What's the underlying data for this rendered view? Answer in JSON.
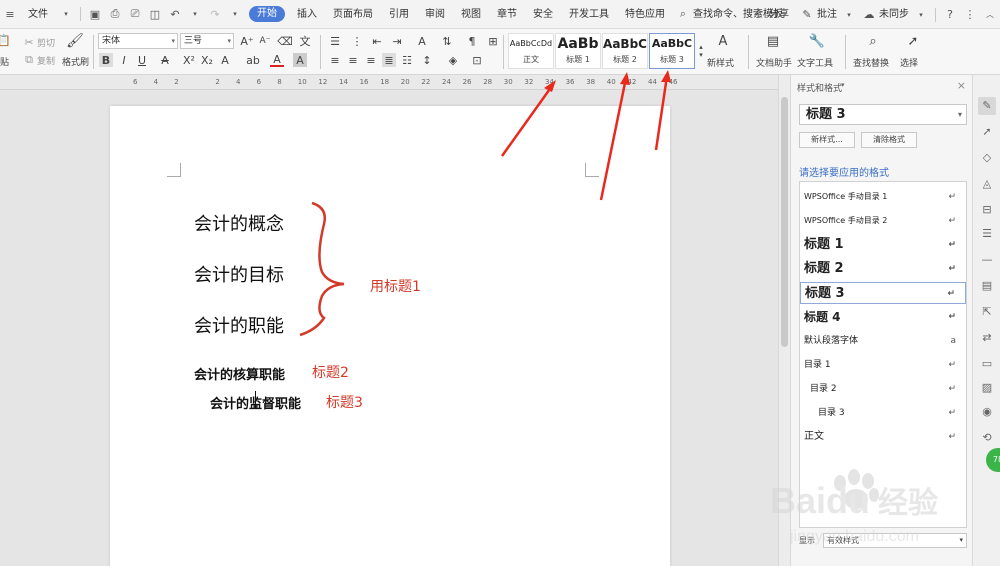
{
  "menubar": {
    "file_label": "文件",
    "tabs": [
      "开始",
      "插入",
      "页面布局",
      "引用",
      "审阅",
      "视图",
      "章节",
      "安全",
      "开发工具",
      "特色应用"
    ],
    "active_tab": "开始",
    "search_label": "查找命令、搜索模板",
    "share_label": "分享",
    "comment_label": "批注",
    "sync_label": "未同步"
  },
  "ribbon": {
    "cut_label": "剪切",
    "copy_label": "复制",
    "paste_label": "贴",
    "format_painter_label": "格式刷",
    "font_name": "宋体",
    "font_size": "三号",
    "styles": [
      {
        "preview": "AaBbCcDd",
        "name": "正文"
      },
      {
        "preview": "AaBb",
        "name": "标题 1"
      },
      {
        "preview": "AaBbC",
        "name": "标题 2"
      },
      {
        "preview": "AaBbC",
        "name": "标题 3"
      }
    ],
    "new_style_label": "新样式",
    "doc_helper_label": "文档助手",
    "text_tools_label": "文字工具",
    "find_replace_label": "查找替换",
    "select_label": "选择"
  },
  "ruler": {
    "ticks": [
      "6",
      "4",
      "2",
      "",
      "2",
      "4",
      "6",
      "8",
      "10",
      "12",
      "14",
      "16",
      "18",
      "20",
      "22",
      "24",
      "26",
      "28",
      "30",
      "32",
      "34",
      "36",
      "38",
      "40",
      "42",
      "44",
      "46"
    ]
  },
  "document": {
    "headings1": [
      "会计的概念",
      "会计的目标",
      "会计的职能"
    ],
    "heading2": "会计的核算职能",
    "heading3": "会计的监督职能",
    "annotation_h1": "用标题1",
    "annotation_h2": "标题2",
    "annotation_h3": "标题3"
  },
  "panel": {
    "title": "样式和格式",
    "current_style": "标题 3",
    "new_style_btn": "新样式...",
    "clear_format_btn": "清除格式",
    "apply_label": "请选择要应用的格式",
    "styles": [
      {
        "label": "WPSOffice 手动目录 1",
        "kind": "small"
      },
      {
        "label": "WPSOffice 手动目录 2",
        "kind": "small"
      },
      {
        "label": "标题 1",
        "kind": "h"
      },
      {
        "label": "标题 2",
        "kind": "h"
      },
      {
        "label": "标题 3",
        "kind": "h",
        "selected": true
      },
      {
        "label": "标题 4",
        "kind": "h4"
      },
      {
        "label": "默认段落字体",
        "kind": "small",
        "mark": "a"
      },
      {
        "label": "目录 1",
        "kind": "toc1"
      },
      {
        "label": "目录 2",
        "kind": "toc2"
      },
      {
        "label": "目录 3",
        "kind": "toc3"
      },
      {
        "label": "正文",
        "kind": "normal"
      }
    ],
    "show_label": "显示",
    "show_value": "有效样式"
  },
  "badge_text": "78",
  "watermark": {
    "brand": "Baidu",
    "brand_cn": "经验",
    "url": "jingyan.baidu.com"
  },
  "colors": {
    "accent": "#4a7bd8",
    "annotation": "#d23a2a",
    "panel_link": "#3b6fc2"
  }
}
